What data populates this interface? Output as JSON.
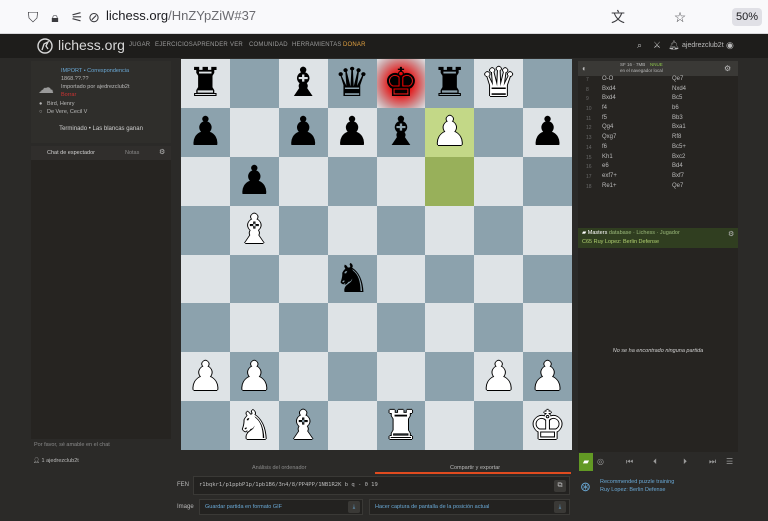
{
  "browser": {
    "url_host": "lichess.org",
    "url_path": "/HnZYpZiW#37",
    "zoom": "50%"
  },
  "site": {
    "logo": "lichess.org",
    "nav": [
      "JUGAR",
      "EJERCICIOS",
      "APRENDER",
      "VER",
      "COMUNIDAD",
      "HERRAMIENTAS",
      "DONAR"
    ],
    "username": "ajedrezclub2t"
  },
  "game": {
    "type": "IMPORT • Correspondencia",
    "date": "1868.??.??",
    "imported_by": "Importado por ajedrezclub2t",
    "variant": "Borrar",
    "white_player": "Bird, Henry",
    "black_player": "De Vere, Cecil V",
    "result_text": "Terminado • Las blancas ganan"
  },
  "chat": {
    "tab_spectator": "Chat de espectador",
    "tab_notes": "Notas",
    "placeholder": "Por favor, sé amable en el chat",
    "footer_users": "1",
    "footer_name": "ajedrezclub2t"
  },
  "board": {
    "rows": [
      [
        "bR",
        "",
        "bB",
        "bQ",
        "bK",
        "bR",
        "wQ",
        ""
      ],
      [
        "bP",
        "",
        "bP",
        "bP",
        "bB",
        "wP",
        "",
        "bP"
      ],
      [
        "",
        "bP",
        "",
        "",
        "",
        "",
        "",
        ""
      ],
      [
        "",
        "wB",
        "",
        "",
        "",
        "",
        "",
        ""
      ],
      [
        "",
        "",
        "",
        "bN",
        "",
        "",
        "",
        ""
      ],
      [
        "",
        "",
        "",
        "",
        "",
        "",
        "",
        ""
      ],
      [
        "wP",
        "wP",
        "",
        "",
        "",
        "",
        "wP",
        "wP"
      ],
      [
        "",
        "wN",
        "wB",
        "",
        "wR",
        "",
        "",
        "wK"
      ]
    ]
  },
  "engine": {
    "depth_text": "SF 16 · 7MB",
    "nnue": "NNUE",
    "sub": "en el navegador local"
  },
  "moves": [
    {
      "n": "7",
      "w": "O-O",
      "b": "Qe7"
    },
    {
      "n": "8",
      "w": "Bxd4",
      "b": "Nxd4"
    },
    {
      "n": "9",
      "w": "Bxd4",
      "b": "Bc5"
    },
    {
      "n": "10",
      "w": "f4",
      "b": "b6"
    },
    {
      "n": "11",
      "w": "f5",
      "b": "Bb3"
    },
    {
      "n": "12",
      "w": "Qg4",
      "b": "Bxa1"
    },
    {
      "n": "13",
      "w": "Qxg7",
      "b": "Rf8"
    },
    {
      "n": "14",
      "w": "f6",
      "b": "Bc5+"
    },
    {
      "n": "15",
      "w": "Kh1",
      "b": "Bxc2"
    },
    {
      "n": "16",
      "w": "e6",
      "b": "Bd4"
    },
    {
      "n": "17",
      "w": "exf7+",
      "b": "Bxf7"
    },
    {
      "n": "18",
      "w": "Re1+",
      "b": "Qe7"
    }
  ],
  "explorer": {
    "title": "Masters",
    "sub_tabs": "database · Lichess · Jugador",
    "opening": "C65 Ruy Lopez: Berlin Defense",
    "empty": "No se ha encontrado ninguna partida"
  },
  "tools": {
    "tab_analysis": "Análisis del ordenador",
    "tab_share": "Compartir y exportar",
    "fen_label": "FEN",
    "fen_value": "r1bqkr1/p1ppbP1p/1pb1B6/3n4/8/PP4PP/1NB1R2K b q - 0 19",
    "image_label": "Image",
    "gif_btn": "Guardar partida en formato GIF",
    "screenshot_btn": "Hacer captura de pantalla de la posición actual"
  },
  "puzzle": {
    "line1": "Recommended puzzle training",
    "line2": "Ruy Lopez: Berlin Defense"
  }
}
